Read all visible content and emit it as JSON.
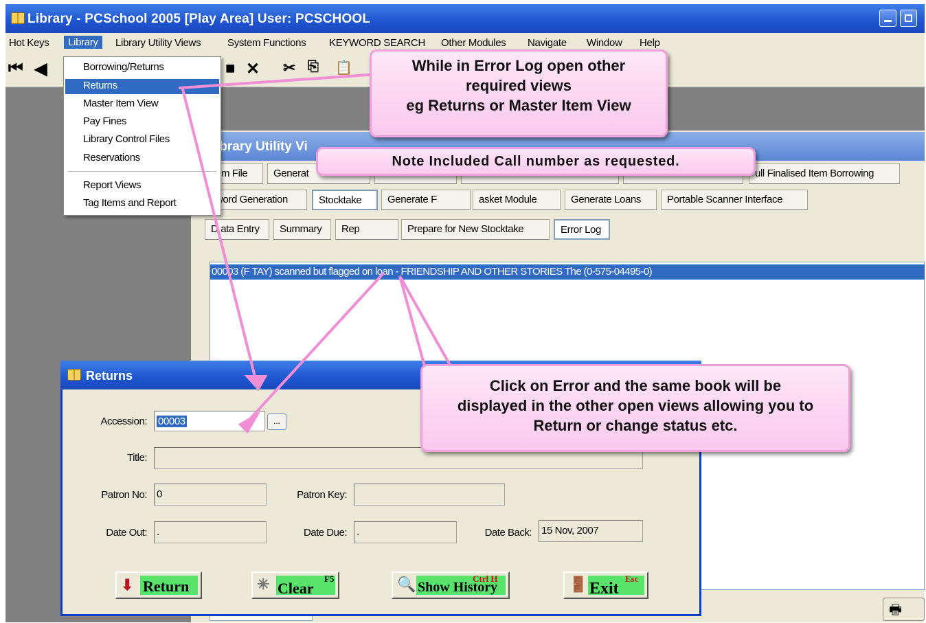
{
  "app": {
    "title": "Library - PCSchool 2005 [Play Area]  User: PCSCHOOL"
  },
  "menubar": {
    "items": [
      "Hot Keys",
      "Library",
      "Library Utility Views",
      "System Functions",
      "KEYWORD SEARCH",
      "Other Modules",
      "Navigate",
      "Window",
      "Help"
    ]
  },
  "library_menu": {
    "items": [
      "Borrowing/Returns",
      "Returns",
      "Master Item View",
      "Pay Fines",
      "Library Control Files",
      "Reservations",
      "Report Views",
      "Tag Items and Report"
    ],
    "selected": "Returns"
  },
  "utility_window": {
    "title": "ibrary Utility Vi",
    "tabs_row1": [
      "em File",
      "Generat",
      "ull Finalised Item Borrowing"
    ],
    "tabs_row2": [
      "word Generation",
      "Stocktake",
      "Generate F",
      "asket Module",
      "Generate Loans",
      "Portable Scanner Interface"
    ],
    "tabs_row3": [
      "D ata Entry",
      "Summary",
      "Rep",
      "Prepare for New Stocktake",
      "Error Log"
    ],
    "error_row": "00003 (F TAY) scanned but flagged on loan - FRIENDSHIP AND OTHER STORIES The (0-575-04495-0)"
  },
  "returns_dialog": {
    "title": "Returns",
    "accession_label": "Accession:",
    "accession_value": "00003",
    "lookup_label": "...",
    "title_label": "Title:",
    "title_value": "",
    "patron_no_label": "Patron No:",
    "patron_no_value": "0",
    "patron_key_label": "Patron Key:",
    "patron_key_value": "",
    "date_out_label": "Date Out:",
    "date_out_value": "  .",
    "date_due_label": "Date Due:",
    "date_due_value": "  .",
    "date_back_label": "Date Back:",
    "date_back_value": "15 Nov, 2007",
    "buttons": {
      "return": "Return",
      "clear": "Clear",
      "clear_key": "F5",
      "history": "Show History",
      "history_key": "Ctrl H",
      "exit": "Exit",
      "exit_key": "Esc"
    }
  },
  "callouts": {
    "top": [
      "While in Error Log open other",
      "required views",
      "eg Returns or Master Item View"
    ],
    "note": "Note Included Call number as requested.",
    "bottom": [
      "Click on Error and the same book will be",
      "displayed in the other open views allowing you to",
      "Return or change status etc."
    ]
  },
  "colors": {
    "title_bar": "#1f55d0",
    "selection": "#316ac5",
    "callout_fill": "#fbc9ee",
    "arrow": "#f08fd6",
    "button_face": "#58e36a"
  }
}
